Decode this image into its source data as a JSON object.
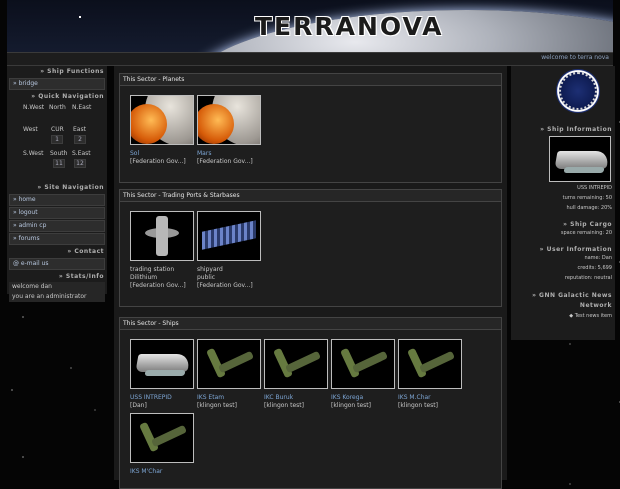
{
  "banner": {
    "title": "TERRANOVA"
  },
  "welcome": "welcome to terra nova",
  "left": {
    "ship_functions": {
      "heading": "» Ship Functions",
      "items": [
        "» bridge"
      ]
    },
    "quick_nav": {
      "heading": "» Quick Navigation",
      "labels": [
        "N.West",
        "North",
        "N.East",
        "West",
        "CUR",
        "East",
        "S.West",
        "South",
        "S.East"
      ],
      "numbers": {
        "cur": "1",
        "east": "2",
        "south": "11",
        "seast": "12"
      }
    },
    "site_nav": {
      "heading": "» Site Navigation",
      "items": [
        "» home",
        "» logout",
        "» admin cp",
        "» forums"
      ]
    },
    "contact": {
      "heading": "» Contact",
      "items": [
        "@ e-mail us"
      ]
    },
    "stats": {
      "heading": "» Stats/Info",
      "lines": [
        "welcome dan",
        "you are an administrator"
      ]
    }
  },
  "main": {
    "planets": {
      "heading": "This Sector - Planets",
      "tiles": [
        {
          "name": "Sol",
          "sub": "[Federation Gov...]"
        },
        {
          "name": "Mars",
          "sub": "[Federation Gov...]"
        }
      ]
    },
    "ports": {
      "heading": "This Sector - Trading Ports & Starbases",
      "tiles": [
        {
          "name": "trading station",
          "sub": "Dilithium",
          "sub2": "[Federation Gov...]"
        },
        {
          "name": "shipyard",
          "sub": "public",
          "sub2": "[Federation Gov...]"
        }
      ]
    },
    "ships": {
      "heading": "This Sector - Ships",
      "tiles": [
        {
          "name": "USS INTREPID",
          "sub": "[Dan]"
        },
        {
          "name": "IKS Etam",
          "sub": "[klingon test]"
        },
        {
          "name": "IKC Buruk",
          "sub": "[klingon test]"
        },
        {
          "name": "IKS Korega",
          "sub": "[klingon test]"
        },
        {
          "name": "IKS M.Char",
          "sub": "[klingon test]"
        },
        {
          "name": "IKS M'Char",
          "sub": ""
        }
      ]
    }
  },
  "right": {
    "ship_info": {
      "heading": "» Ship Information",
      "name": "USS INTREPID",
      "turns": "turns remaining: 50",
      "hull": "hull damage: 20%"
    },
    "cargo": {
      "heading": "» Ship Cargo",
      "space": "space remaining: 20"
    },
    "user": {
      "heading": "» User Information",
      "name": "name: Dan",
      "credits": "credits: 5,699",
      "rep": "reputation: neutral"
    },
    "news": {
      "heading": "» GNN Galactic News Network",
      "item": "Test news item"
    }
  }
}
